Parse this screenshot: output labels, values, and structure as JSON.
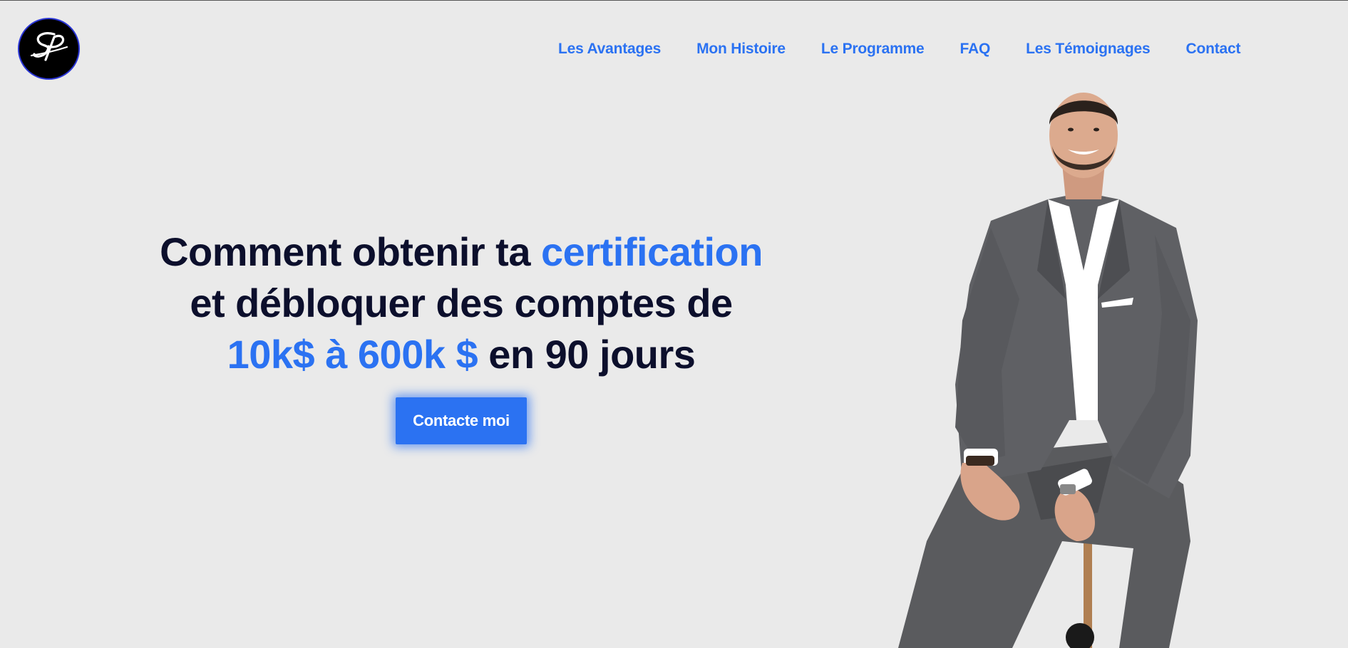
{
  "header": {
    "logo_text": "SP",
    "nav": [
      "Les Avantages",
      "Mon Histoire",
      "Le Programme",
      "FAQ",
      "Les Témoignages",
      "Contact"
    ]
  },
  "hero": {
    "line1_plain": "Comment obtenir ta ",
    "line1_accent": "certification",
    "line2_plain": "et débloquer des comptes de",
    "line3_accent": "10k$ à 600k $",
    "line3_plain": " en 90 jours",
    "cta_label": "Contacte moi"
  },
  "colors": {
    "background": "#eaeaea",
    "accent": "#2b72f2",
    "heading": "#0c0f2c"
  },
  "icons": {
    "logo": "sp-signature-logo"
  }
}
